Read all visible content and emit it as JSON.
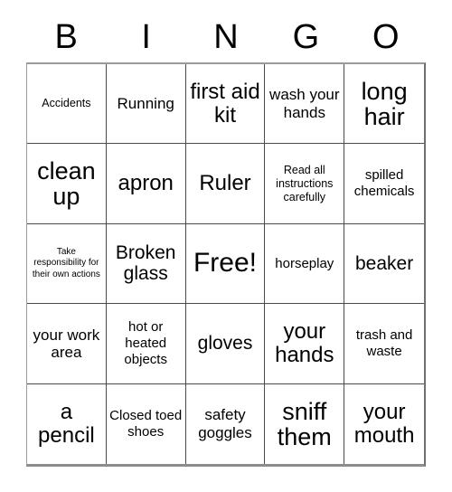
{
  "card": {
    "title": "BINGO",
    "header_letters": [
      "B",
      "I",
      "N",
      "G",
      "O"
    ],
    "background_color": "#ffffff",
    "text_color": "#000000",
    "grid_border_color": "#4a4a4a",
    "outer_border_color": "#8d8d8d",
    "rows": 5,
    "columns": 5,
    "free_space_index": 12,
    "cells": [
      {
        "text": "Accidents",
        "size": "s"
      },
      {
        "text": "Running",
        "size": "l"
      },
      {
        "text": "first aid kit",
        "size": "xxl"
      },
      {
        "text": "wash your hands",
        "size": "l"
      },
      {
        "text": "long hair",
        "size": "3xl"
      },
      {
        "text": "clean up",
        "size": "3xl"
      },
      {
        "text": "apron",
        "size": "xxl"
      },
      {
        "text": "Ruler",
        "size": "xxl"
      },
      {
        "text": "Read all instructions carefully",
        "size": "s"
      },
      {
        "text": "spilled chemicals",
        "size": "m"
      },
      {
        "text": "Take responsibility for their own actions",
        "size": "xs"
      },
      {
        "text": "Broken glass",
        "size": "xl"
      },
      {
        "text": "Free!",
        "size": "free"
      },
      {
        "text": "horseplay",
        "size": "m"
      },
      {
        "text": "beaker",
        "size": "xl"
      },
      {
        "text": "your work area",
        "size": "l"
      },
      {
        "text": "hot or heated objects",
        "size": "m"
      },
      {
        "text": "gloves",
        "size": "xl"
      },
      {
        "text": "your hands",
        "size": "xxl"
      },
      {
        "text": "trash and waste",
        "size": "m"
      },
      {
        "text": "a pencil",
        "size": "xxl"
      },
      {
        "text": "Closed toed shoes",
        "size": "m"
      },
      {
        "text": "safety goggles",
        "size": "l"
      },
      {
        "text": "sniff them",
        "size": "3xl"
      },
      {
        "text": "your mouth",
        "size": "xxl"
      }
    ]
  }
}
